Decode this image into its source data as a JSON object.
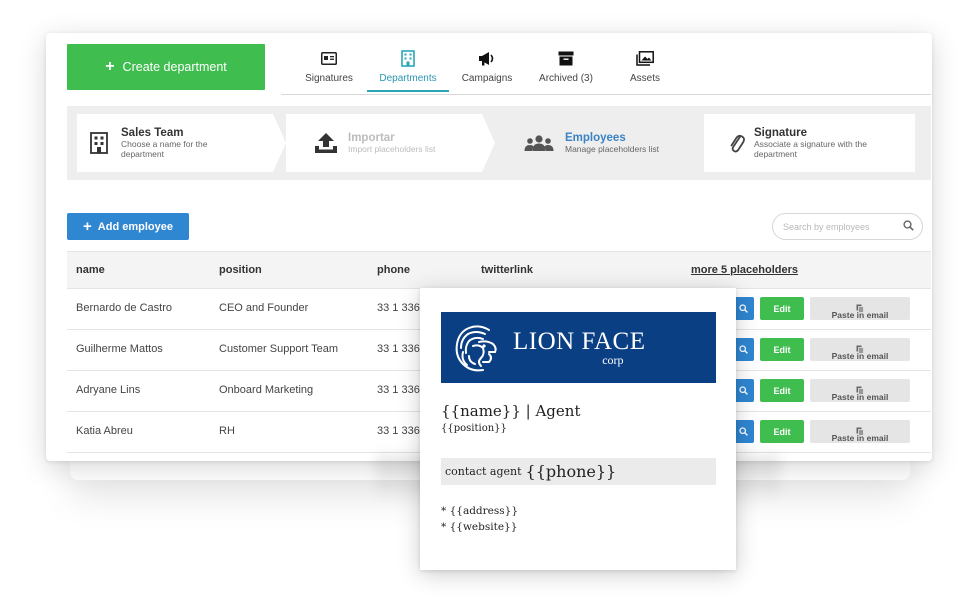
{
  "header": {
    "create_button": "Create department",
    "tabs": [
      {
        "label": "Signatures",
        "icon": "id-card-icon"
      },
      {
        "label": "Departments",
        "icon": "building-icon",
        "active": true
      },
      {
        "label": "Campaigns",
        "icon": "megaphone-icon"
      },
      {
        "label": "Archived (3)",
        "icon": "archive-box-icon"
      },
      {
        "label": "Assets",
        "icon": "images-icon"
      }
    ]
  },
  "steps": [
    {
      "title": "Sales Team",
      "subtitle": "Choose a name for the department",
      "icon": "building-icon",
      "state": "done"
    },
    {
      "title": "Importar",
      "subtitle": "Import placeholders list",
      "icon": "upload-icon",
      "state": "disabled"
    },
    {
      "title": "Employees",
      "subtitle": "Manage placeholders list",
      "icon": "users-icon",
      "state": "active"
    },
    {
      "title": "Signature",
      "subtitle": "Associate a signature with the department",
      "icon": "paperclip-icon",
      "state": "todo"
    }
  ],
  "toolbar": {
    "add_button": "Add employee",
    "search_placeholder": "Search by employees"
  },
  "table": {
    "columns": [
      "name",
      "position",
      "phone",
      "twitterlink",
      "more 5 placeholders"
    ],
    "rows": [
      {
        "name": "Bernardo de Castro",
        "position": "CEO and Founder",
        "phone": "33 1 336-"
      },
      {
        "name": "Guilherme Mattos",
        "position": "Customer Support Team",
        "phone": "33 1 336-"
      },
      {
        "name": "Adryane Lins",
        "position": "Onboard Marketing",
        "phone": "33 1 336-"
      },
      {
        "name": "Katia Abreu",
        "position": "RH",
        "phone": "33 1 336-"
      }
    ],
    "edit_label": "Edit",
    "paste_label": "Paste in email"
  },
  "signature": {
    "logo_name": "LION FACE",
    "logo_sub": "corp",
    "name_line": "{{name}} | Agent",
    "position_line": "{{position}}",
    "contact_prefix": "contact agent",
    "contact_value": "{{phone}}",
    "list": [
      "* {{address}}",
      "* {{website}}"
    ]
  },
  "colors": {
    "create_green": "#3fbd4f",
    "primary_blue": "#2f86d1",
    "active_tab": "#2a96b0",
    "logo_navy": "#0b3f84"
  }
}
